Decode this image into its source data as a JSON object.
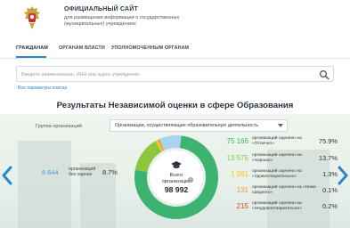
{
  "header": {
    "title": "ОФИЦИАЛЬНЫЙ САЙТ",
    "subtitle": "для размещения информации о государственных (муниципальных) учреждениях",
    "emblem_icon": "coat-of-arms-icon"
  },
  "nav": {
    "items": [
      {
        "label": "ГРАЖДАНАМ",
        "active": true
      },
      {
        "label": "ОРГАНАМ ВЛАСТИ",
        "active": false
      },
      {
        "label": "УПОЛНОМОЧЕННЫМ ОРГАНАМ",
        "active": false
      }
    ],
    "accent": "#2a88c8"
  },
  "search": {
    "value": "",
    "placeholder": "Введите наименование, ИНН или адрес учреждения",
    "button_icon": "search-icon",
    "advanced_link": "Все параметры поиска"
  },
  "results": {
    "title": "Результаты Независимой оценки в сфере Образования",
    "group_label": "Группа организаций",
    "group_selected": "Организации, осуществляющие образовательную деятельность",
    "no_rating": {
      "count": "8 644",
      "label": "организаций без оценки",
      "percent": "8.7%"
    },
    "total_label": "Всего организаций",
    "total": "98 992",
    "help": "?",
    "rows": [
      {
        "count": "75 166",
        "label": "организаций оценено на «Отлично»",
        "percent": "75.9%",
        "color": "#3cb371"
      },
      {
        "count": "13 575",
        "label": "организаций оценено на «Хорошо»",
        "percent": "13.7%",
        "color": "#8cc63f"
      },
      {
        "count": "1 261",
        "label": "организаций оценено на «Удовлетворительно»",
        "percent": "1.3%",
        "color": "#f5c518"
      },
      {
        "count": "131",
        "label": "организаций оценено на «Ниже среднего»",
        "percent": "0.1%",
        "color": "#f39c2b"
      },
      {
        "count": "215",
        "label": "организаций оценено на «Неудовлетворительно»",
        "percent": "0.2%",
        "color": "#e0452c"
      }
    ],
    "no_rating_color": "#a8d4ee"
  }
}
